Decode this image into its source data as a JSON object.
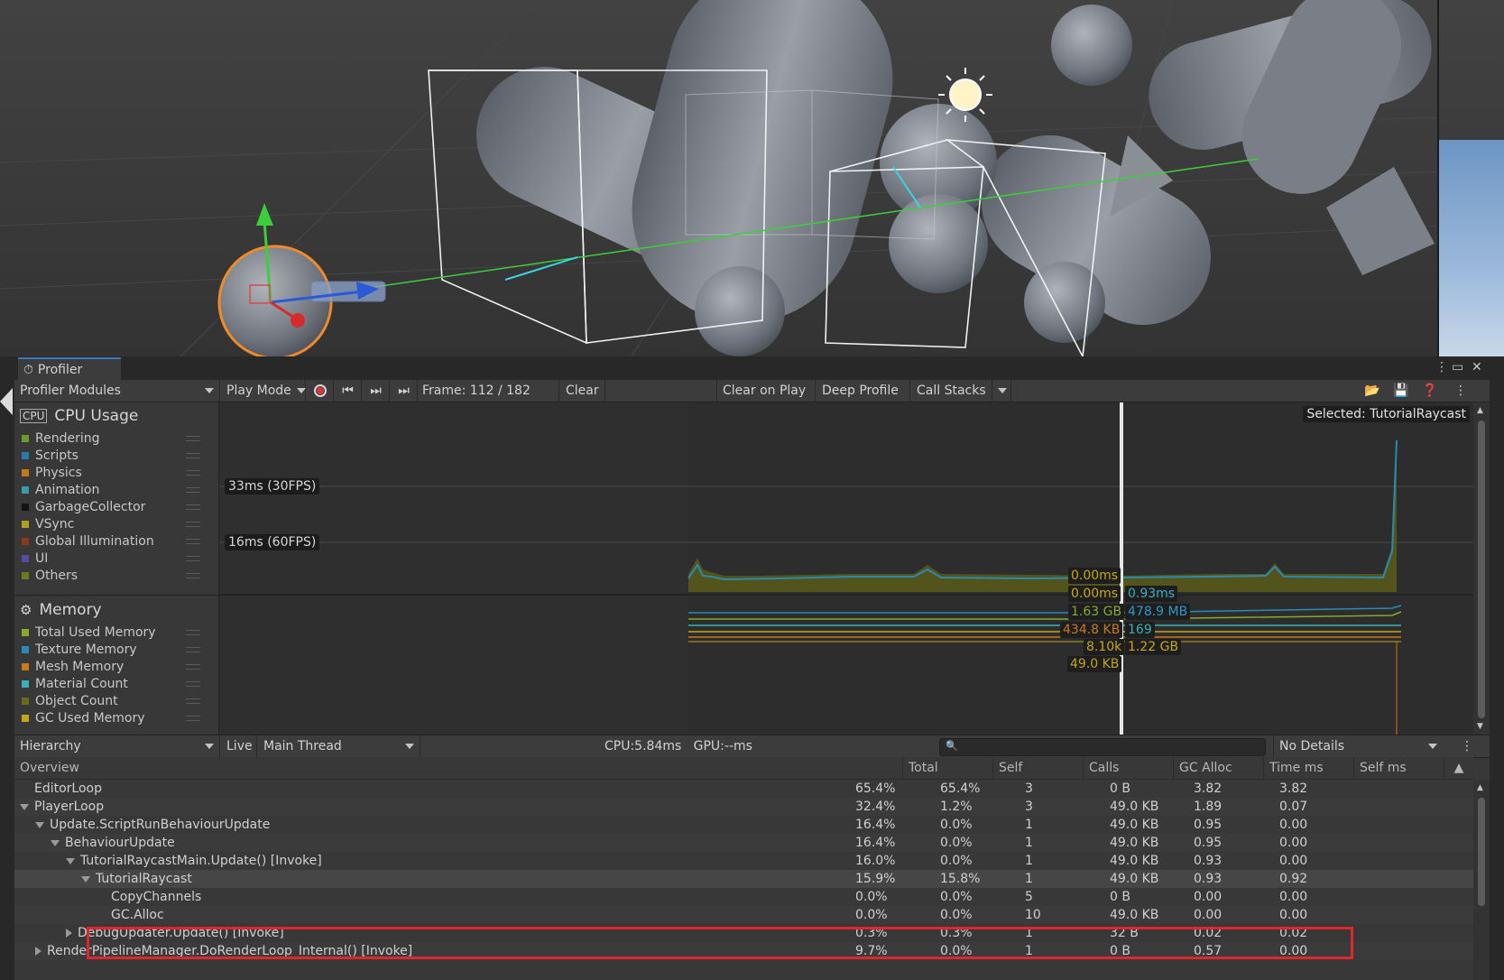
{
  "window": {
    "tab_title": "Profiler"
  },
  "toolbar": {
    "modules_label": "Profiler Modules",
    "play_mode_label": "Play Mode",
    "frame_label": "Frame: 112 / 182",
    "clear_label": "Clear",
    "clear_on_play_label": "Clear on Play",
    "deep_profile_label": "Deep Profile",
    "call_stacks_label": "Call Stacks"
  },
  "cpu_module": {
    "title": "CPU Usage",
    "legend": [
      {
        "label": "Rendering",
        "color": "#6a9a2a"
      },
      {
        "label": "Scripts",
        "color": "#2a7ab0"
      },
      {
        "label": "Physics",
        "color": "#c07a18"
      },
      {
        "label": "Animation",
        "color": "#3a9aa8"
      },
      {
        "label": "GarbageCollector",
        "color": "#141414"
      },
      {
        "label": "VSync",
        "color": "#b0a01a"
      },
      {
        "label": "Global Illumination",
        "color": "#8a3a1a"
      },
      {
        "label": "UI",
        "color": "#5a4aa8"
      },
      {
        "label": "Others",
        "color": "#6a7a1a"
      }
    ],
    "fps_lines": [
      "33ms (30FPS)",
      "16ms (60FPS)"
    ],
    "selected_label": "Selected: TutorialRaycast",
    "values": [
      "0.00ms",
      "0.00ms",
      "0.93ms"
    ]
  },
  "memory_module": {
    "title": "Memory",
    "legend": [
      {
        "label": "Total Used Memory",
        "color": "#8aa82a"
      },
      {
        "label": "Texture Memory",
        "color": "#2a8ab8"
      },
      {
        "label": "Mesh Memory",
        "color": "#c87a1a"
      },
      {
        "label": "Material Count",
        "color": "#3ab0b8"
      },
      {
        "label": "Object Count",
        "color": "#6a6a1a"
      },
      {
        "label": "GC Used Memory",
        "color": "#c0a818"
      }
    ],
    "values_left": [
      "1.63 GB",
      "434.8 KB",
      "8.10k",
      "49.0 KB"
    ],
    "values_right": [
      "478.9 MB",
      "169",
      "1.22 GB"
    ]
  },
  "detail_bar": {
    "view_label": "Hierarchy",
    "live_label": "Live",
    "thread_label": "Main Thread",
    "cpu_gpu_label": "CPU:5.84ms   GPU:--ms",
    "details_label": "No Details"
  },
  "hierarchy": {
    "columns": [
      "Overview",
      "Total",
      "Self",
      "Calls",
      "GC Alloc",
      "Time ms",
      "Self ms"
    ],
    "rows": [
      {
        "name": "EditorLoop",
        "total": "65.4%",
        "self": "65.4%",
        "calls": "3",
        "gc": "0 B",
        "time": "3.82",
        "selfms": "3.82"
      },
      {
        "name": "PlayerLoop",
        "total": "32.4%",
        "self": "1.2%",
        "calls": "3",
        "gc": "49.0 KB",
        "time": "1.89",
        "selfms": "0.07"
      },
      {
        "name": "Update.ScriptRunBehaviourUpdate",
        "total": "16.4%",
        "self": "0.0%",
        "calls": "1",
        "gc": "49.0 KB",
        "time": "0.95",
        "selfms": "0.00"
      },
      {
        "name": "BehaviourUpdate",
        "total": "16.4%",
        "self": "0.0%",
        "calls": "1",
        "gc": "49.0 KB",
        "time": "0.95",
        "selfms": "0.00"
      },
      {
        "name": "TutorialRaycastMain.Update() [Invoke]",
        "total": "16.0%",
        "self": "0.0%",
        "calls": "1",
        "gc": "49.0 KB",
        "time": "0.93",
        "selfms": "0.00"
      },
      {
        "name": "TutorialRaycast",
        "total": "15.9%",
        "self": "15.8%",
        "calls": "1",
        "gc": "49.0 KB",
        "time": "0.93",
        "selfms": "0.92"
      },
      {
        "name": "CopyChannels",
        "total": "0.0%",
        "self": "0.0%",
        "calls": "5",
        "gc": "0 B",
        "time": "0.00",
        "selfms": "0.00"
      },
      {
        "name": "GC.Alloc",
        "total": "0.0%",
        "self": "0.0%",
        "calls": "10",
        "gc": "49.0 KB",
        "time": "0.00",
        "selfms": "0.00"
      },
      {
        "name": "DebugUpdater.Update() [Invoke]",
        "total": "0.3%",
        "self": "0.3%",
        "calls": "1",
        "gc": "32 B",
        "time": "0.02",
        "selfms": "0.02"
      },
      {
        "name": "RenderPipelineManager.DoRenderLoop_Internal() [Invoke]",
        "total": "9.7%",
        "self": "0.0%",
        "calls": "1",
        "gc": "0 B",
        "time": "0.57",
        "selfms": "0.00"
      }
    ]
  }
}
